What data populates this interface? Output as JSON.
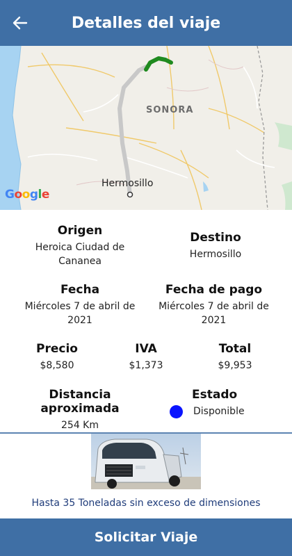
{
  "header": {
    "title": "Detalles del viaje",
    "back_icon": "arrow-left-icon"
  },
  "map": {
    "region_label": "SONORA",
    "city_label": "Hermosillo",
    "attribution": "Google"
  },
  "trip": {
    "origen_label": "Origen",
    "origen_value": "Heroica Ciudad de Cananea",
    "destino_label": "Destino",
    "destino_value": "Hermosillo",
    "fecha_label": "Fecha",
    "fecha_value": "Miércoles 7 de abril de 2021",
    "fecha_pago_label": "Fecha de pago",
    "fecha_pago_value": "Miércoles 7 de abril de 2021",
    "precio_label": "Precio",
    "precio_value": "$8,580",
    "iva_label": "IVA",
    "iva_value": "$1,373",
    "total_label": "Total",
    "total_value": "$9,953",
    "distancia_label": "Distancia aproximada",
    "distancia_value": "254 Km",
    "estado_label": "Estado",
    "estado_value": "Disponible",
    "estado_color": "#0a14ff"
  },
  "truck": {
    "capacity_text": "Hasta 35 Toneladas sin exceso de dimensiones"
  },
  "action": {
    "request_label": "Solicitar Viaje"
  },
  "colors": {
    "primary": "#3f6fa5",
    "route_active": "#1f8a1f",
    "route_inactive": "#c8c8c8"
  }
}
